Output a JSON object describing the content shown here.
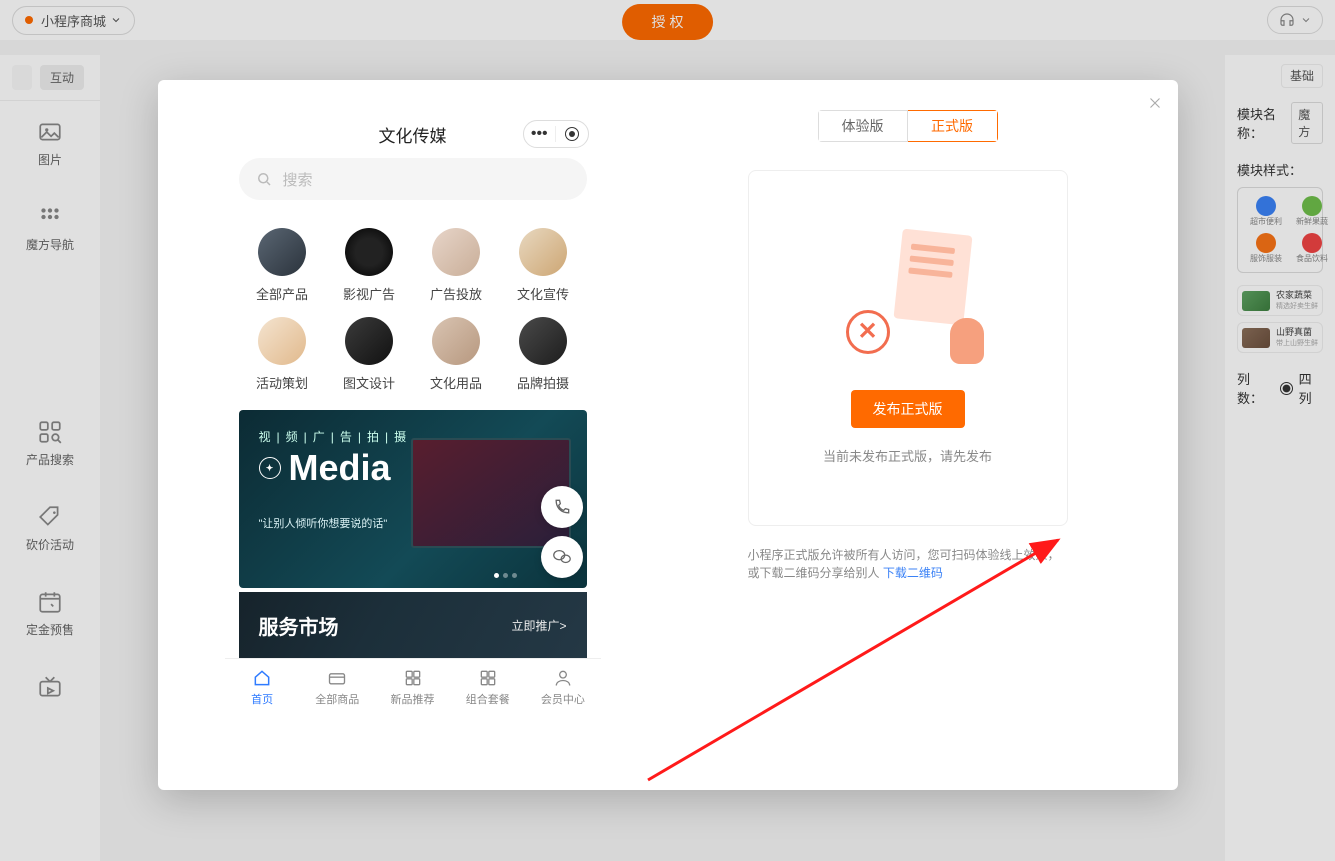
{
  "topbar": {
    "app_name": "小程序商城",
    "auth_btn": "授 权"
  },
  "left_rail": {
    "pill_b": "互动",
    "items": [
      {
        "label": "图片"
      },
      {
        "label": "魔方导航"
      },
      {
        "label": "产品搜索"
      },
      {
        "label": "砍价活动"
      },
      {
        "label": "定金预售"
      }
    ]
  },
  "right_panel": {
    "tab_basic": "基础",
    "module_name_label": "模块名称：",
    "module_name_value": "魔方",
    "module_style_label": "模块样式：",
    "cols_label": "列数：",
    "col_option": "四列",
    "sample_cells": [
      {
        "label": "超市便利",
        "color": "#3b82f6"
      },
      {
        "label": "新鲜果蔬",
        "color": "#6fbf4b"
      },
      {
        "label": "服饰服装",
        "color": "#f97316"
      },
      {
        "label": "食品饮料",
        "color": "#ef4444"
      }
    ],
    "list_samples": [
      {
        "title": "农家蔬菜",
        "sub": "精选好卖生鲜"
      },
      {
        "title": "山野真菌",
        "sub": "带上山野生鲜"
      }
    ]
  },
  "modal": {
    "phone": {
      "title": "文化传媒",
      "search_placeholder": "搜索",
      "categories": [
        {
          "label": "全部产品",
          "bg": "linear-gradient(135deg,#5a6673,#2b333c)"
        },
        {
          "label": "影视广告",
          "bg": "radial-gradient(circle,#222 40%,#000)"
        },
        {
          "label": "广告投放",
          "bg": "linear-gradient(135deg,#e7d5c9,#c9ae98)"
        },
        {
          "label": "文化宣传",
          "bg": "linear-gradient(135deg,#e8d8c0,#cda673)"
        },
        {
          "label": "活动策划",
          "bg": "linear-gradient(135deg,#f4e4d0,#e1b98c)"
        },
        {
          "label": "图文设计",
          "bg": "linear-gradient(135deg,#3b3b3b,#111)"
        },
        {
          "label": "文化用品",
          "bg": "linear-gradient(135deg,#d9c4b2,#b7987f)"
        },
        {
          "label": "品牌拍摄",
          "bg": "linear-gradient(135deg,#4a4a4a,#1d1d1d)"
        }
      ],
      "banner": {
        "sub": "视|频|广|告|拍|摄",
        "title": "Media",
        "quote": "\"让别人倾听你想要说的话\""
      },
      "service_title": "服务市场",
      "service_cta": "立即推广>",
      "tabs": [
        {
          "label": "首页",
          "active": true
        },
        {
          "label": "全部商品",
          "active": false
        },
        {
          "label": "新品推荐",
          "active": false
        },
        {
          "label": "组合套餐",
          "active": false
        },
        {
          "label": "会员中心",
          "active": false
        }
      ]
    },
    "version_tabs": {
      "trial": "体验版",
      "release": "正式版"
    },
    "publish_button": "发布正式版",
    "status_text": "当前未发布正式版，请先发布",
    "description": "小程序正式版允许被所有人访问，您可扫码体验线上效果，或下载二维码分享给别人 ",
    "download_link": "下载二维码"
  }
}
